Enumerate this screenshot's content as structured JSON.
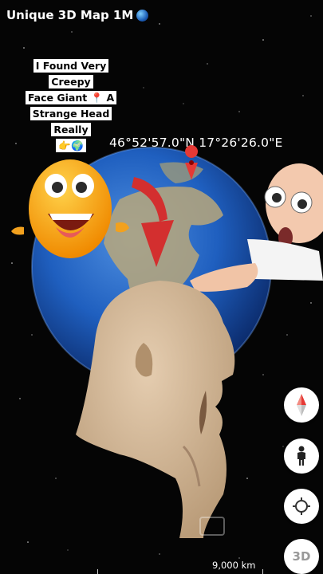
{
  "header": {
    "channel_title": "Unique 3D Map 1M"
  },
  "caption": {
    "lines": [
      "I Found Very Creepy",
      "Face Giant 📍 A",
      "Strange Head Really",
      "👉🌍"
    ]
  },
  "location": {
    "coordinates": "46°52'57.0\"N 17°26'26.0\"E"
  },
  "controls": {
    "compass": "compass-icon",
    "street_view": "pegman-icon",
    "my_location": "crosshair-icon",
    "view_3d_label": "3D"
  },
  "map": {
    "scale_label": "9,000 km"
  },
  "colors": {
    "accent_red": "#e53935",
    "globe_blue": "#1f5fbf"
  }
}
